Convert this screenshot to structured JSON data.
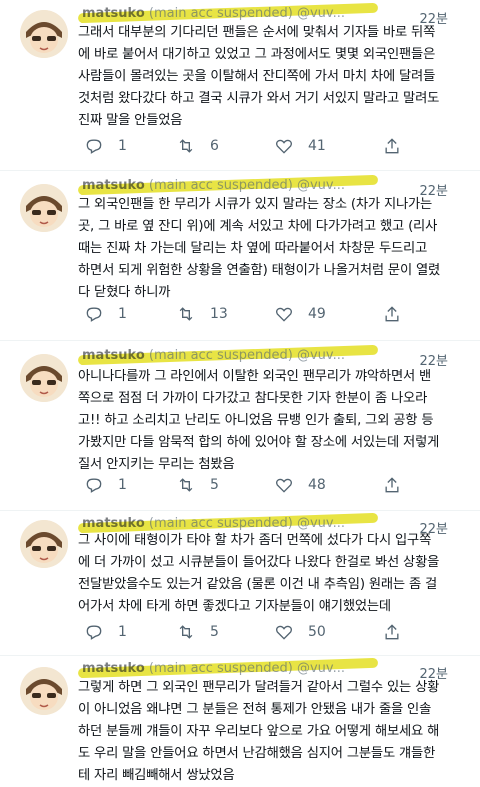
{
  "tweets": [
    {
      "name": "matsuko",
      "handle": "(main acc suspended) @vuv...",
      "time": "22분",
      "text": "그래서 대부분의 기다리던 팬들은 순서에 맞춰서 기자들 바로 뒤쪽\n에 바로 붙어서 대기하고 있었고 그 과정에서도 몇몇 외국인팬들은\n사람들이 몰려있는 곳을 이탈해서 잔디쪽에 가서 마치 차에 달려들\n것처럼 왔다갔다 하고 결국 시큐가 와서 거기 서있지 말라고 말려도\n진짜 말을 안들었음",
      "replies": "1",
      "retweets": "6",
      "likes": "41"
    },
    {
      "name": "matsuko",
      "handle": "(main acc suspended) @vuv...",
      "time": "22분",
      "text": "그 외국인팬들 한 무리가 시큐가 있지 말라는 장소 (차가 지나가는\n곳, 그 바로 옆 잔디 위)에 계속 서있고 차에 다가가려고 했고 (리사\n때는 진짜 차 가는데 달리는 차 옆에 따라붙어서 차창문 두드리고\n하면서 되게 위험한 상황을 연출함) 태형이가 나올거처럼 문이 열렸\n다 닫혔다 하니까",
      "replies": "1",
      "retweets": "13",
      "likes": "49"
    },
    {
      "name": "matsuko",
      "handle": "(main acc suspended) @vuv...",
      "time": "22분",
      "text": "아니나다를까 그 라인에서 이탈한 외국인 팬무리가 꺄악하면서 밴\n쪽으로 점점 더 가까이 다가갔고 참다못한 기자 한분이 좀 나오라\n고!! 하고 소리치고 난리도 아니었음 뮤뱅 인가 출퇴, 그외 공항 등\n가봤지만 다들 암묵적 합의 하에 있어야 할 장소에 서있는데 저렇게\n질서 안지키는 무리는 첨봤음",
      "replies": "1",
      "retweets": "5",
      "likes": "48"
    },
    {
      "name": "matsuko",
      "handle": "(main acc suspended) @vuv...",
      "time": "22분",
      "text": "그 사이에 태형이가 타야 할 차가 좀더 먼쪽에 섰다가 다시 입구쪽\n에 더 가까이 섰고 시큐분들이 들어갔다 나왔다 한걸로 봐선 상황을\n전달받았을수도 있는거 같았음 (물론 이건 내 추측임) 원래는 좀 걸\n어가서 차에 타게 하면 좋겠다고 기자분들이 얘기했었는데",
      "replies": "1",
      "retweets": "5",
      "likes": "50"
    },
    {
      "name": "matsuko",
      "handle": "(main acc suspended) @vuv...",
      "time": "22분",
      "text": "그렇게 하면 그 외국인 팬무리가 달려들거 같아서 그럴수 있는 상황\n이 아니었음 왜냐면 그 분들은 전혀 통제가 안됐음 내가 줄을 인솔\n하던 분들께 걔들이 자꾸 우리보다 앞으로 가요 어떻게 해보세요 해\n도 우리 말을 안들어요 하면서 난감해했음 심지어 그분들도 걔들한\n테 자리 빼김빼해서 쌍났었음",
      "replies": "",
      "retweets": "",
      "likes": ""
    }
  ],
  "colors": {
    "text": "#0f1419",
    "muted": "#536471",
    "highlight": "#e7e33a"
  },
  "icons": [
    "reply-icon",
    "retweet-icon",
    "like-icon"
  ]
}
